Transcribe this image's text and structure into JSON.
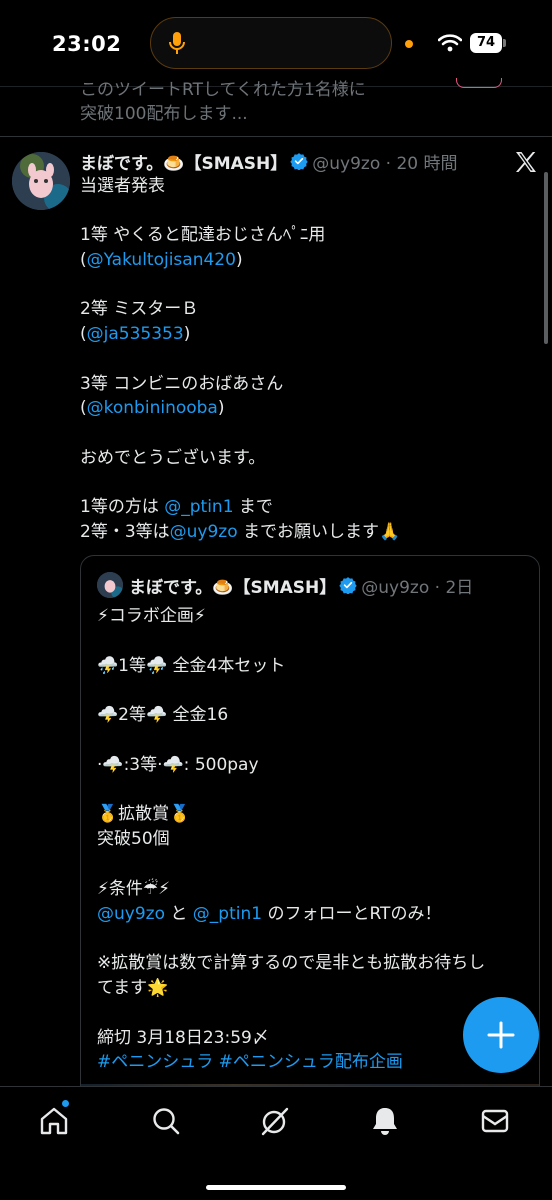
{
  "status_bar": {
    "time": "23:02",
    "battery": "74"
  },
  "previous_tweet": {
    "lines": [
      "このツイートRTしてくれた方1名様に",
      "突破100配布します..."
    ]
  },
  "tweet": {
    "author_name": "まぼです。🍮【SMASH】",
    "handle_time": "@uy9zo · 20 時間",
    "lines": [
      "当選者発表",
      "",
      "1等 やくると配達おじさんﾍﾟﾆ用",
      "(@Yakultojisan420)",
      "",
      "2等 ミスターＢ",
      "(@ja535353)",
      "",
      "3等  コンビニのおばあさん",
      "(@konbininooba)",
      "",
      "おめでとうございます。",
      "",
      "1等の方は @_ptin1 まで",
      "2等・3等は@uy9zo までお願いします🙏"
    ],
    "links": {
      "l1": "@Yakultojisan420",
      "l2": "@ja535353",
      "l3": "@konbininooba",
      "l4": "@_ptin1",
      "l5": "@uy9zo"
    }
  },
  "quoted_tweet": {
    "author_name": "まぼです。🍮【SMASH】",
    "handle_time": "@uy9zo · 2日",
    "lines": [
      "⚡コラボ企画⚡",
      "",
      "⛈️1等⛈️  全金4本セット",
      "",
      "🌩️2等🌩️  全金16",
      "",
      "·🌩️:3等·🌩️:  500pay",
      "",
      "🥇拡散賞🥇",
      "突破50個",
      "",
      "⚡条件☔⚡",
      "@uy9zo と @_ptin1 のフォローとRTのみ！",
      "",
      "※拡散賞は数で計算するので是非とも拡散お待ちし",
      "てます🌟",
      "",
      "締切  3月18日23:59〆",
      " #ペニンシュラ  #ペニンシュラ配布企画"
    ]
  },
  "colors": {
    "accent": "#1d9bf0",
    "text": "#e7e9ea",
    "muted": "#71767b",
    "divider": "#2f3336"
  },
  "nav": {
    "items": [
      "home-icon",
      "search-icon",
      "grok-icon",
      "notifications-icon",
      "messages-icon"
    ]
  },
  "fab": {
    "icon": "plus-icon"
  }
}
